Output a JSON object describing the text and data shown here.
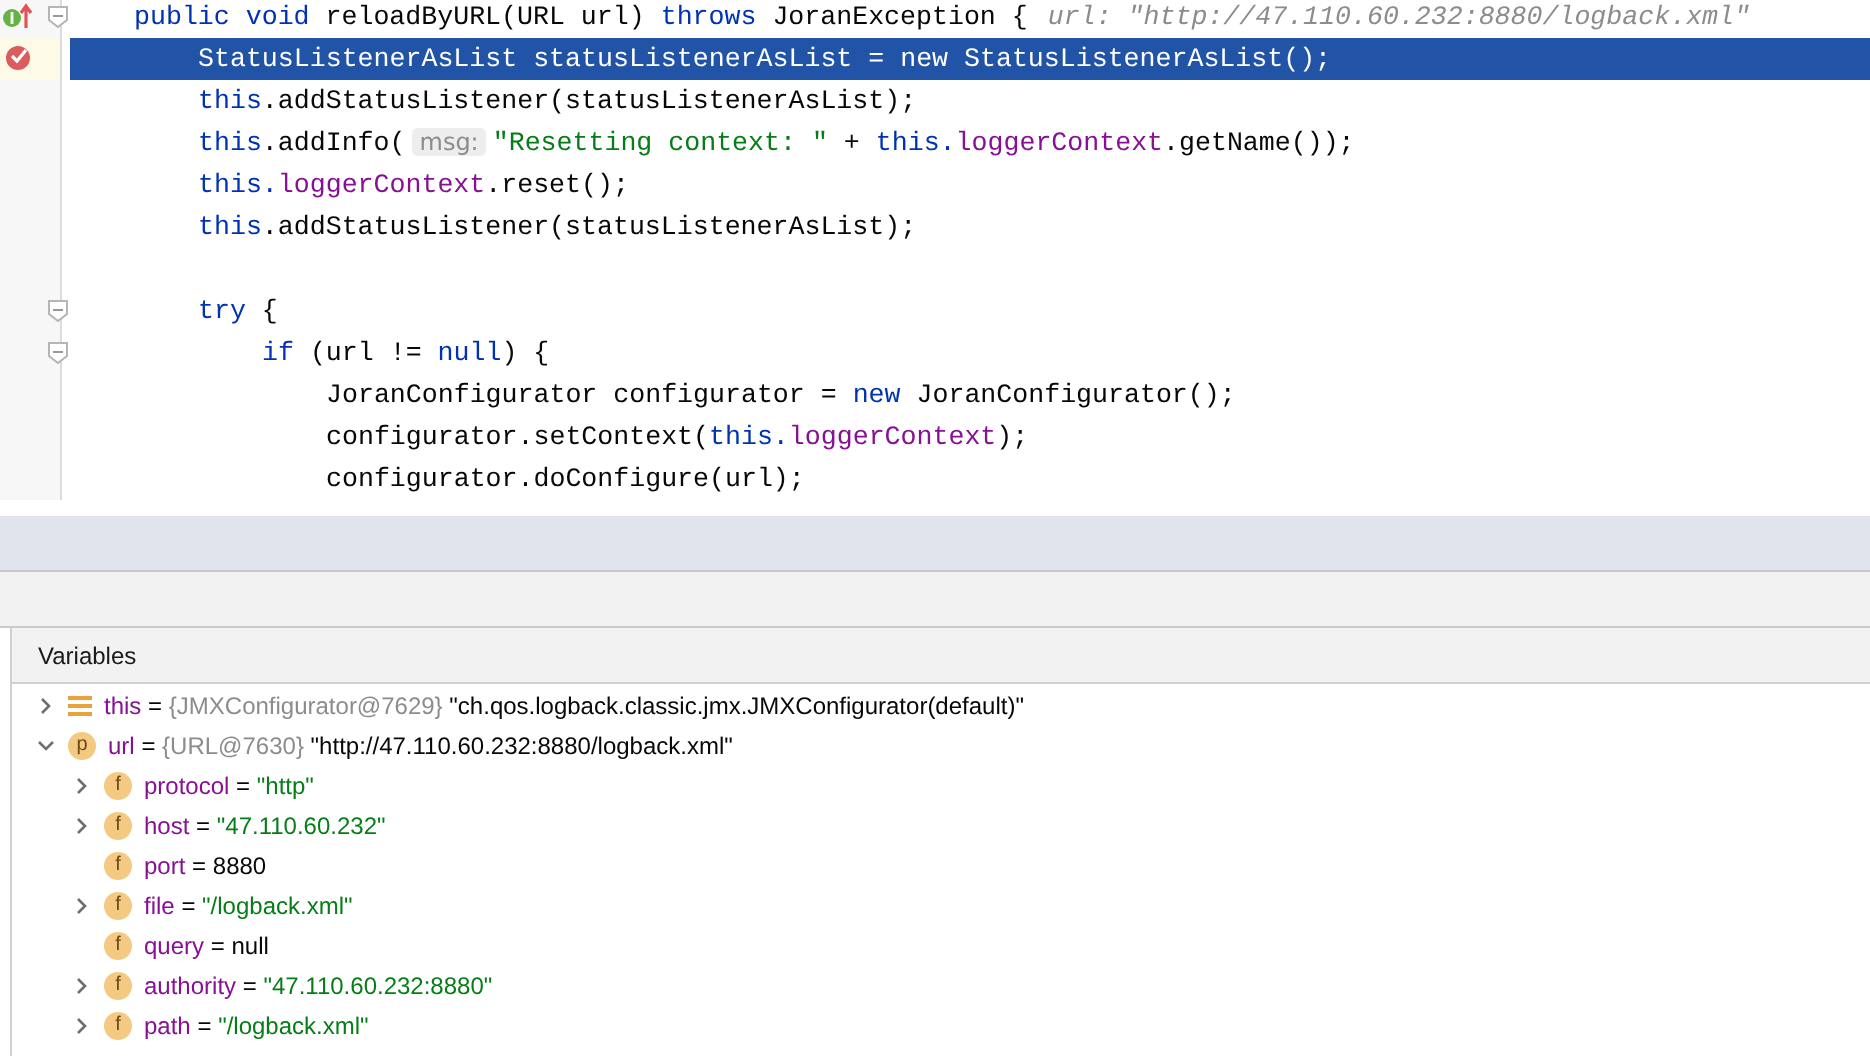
{
  "editor": {
    "lines": [
      {
        "kind": "implements",
        "fold": true,
        "selected": false,
        "segments": [
          {
            "kind": "kw",
            "text": "public void "
          },
          {
            "kind": "plain",
            "text": "reloadByURL(URL url) "
          },
          {
            "kind": "kw",
            "text": "throws "
          },
          {
            "kind": "plain",
            "text": "JoranException {"
          },
          {
            "kind": "inline-hint",
            "text": "url: \"http://47.110.60.232:8880/logback.xml\""
          }
        ],
        "children": [
          {
            "kind": "breakpoint",
            "fold": false,
            "selected": true,
            "segments": [
              {
                "kind": "plain",
                "text": "StatusListenerAsList statusListenerAsList = new StatusListenerAsList();"
              }
            ]
          },
          {
            "fold": false,
            "selected": false,
            "segments": [
              {
                "kind": "kw",
                "text": "this"
              },
              {
                "kind": "plain",
                "text": ".addStatusListener(statusListenerAsList);"
              }
            ]
          },
          {
            "fold": false,
            "selected": false,
            "segments": [
              {
                "kind": "kw",
                "text": "this"
              },
              {
                "kind": "plain",
                "text": ".addInfo("
              },
              {
                "kind": "param-hint",
                "text": "msg:"
              },
              {
                "kind": "str",
                "text": "\"Resetting context: \""
              },
              {
                "kind": "plain",
                "text": " + "
              },
              {
                "kind": "kw",
                "text": "this."
              },
              {
                "kind": "field",
                "text": "loggerContext"
              },
              {
                "kind": "plain",
                "text": ".getName());"
              }
            ]
          },
          {
            "fold": false,
            "selected": false,
            "segments": [
              {
                "kind": "kw",
                "text": "this."
              },
              {
                "kind": "field",
                "text": "loggerContext"
              },
              {
                "kind": "plain",
                "text": ".reset();"
              }
            ]
          },
          {
            "fold": false,
            "selected": false,
            "segments": [
              {
                "kind": "kw",
                "text": "this"
              },
              {
                "kind": "plain",
                "text": ".addStatusListener(statusListenerAsList);"
              }
            ]
          },
          {
            "fold": false,
            "selected": false
          },
          {
            "fold": true,
            "selected": false,
            "segments": [
              {
                "kind": "kw",
                "text": "try "
              },
              {
                "kind": "plain",
                "text": "{"
              }
            ],
            "children": [
              {
                "fold": true,
                "selected": false,
                "segments": [
                  {
                    "kind": "kw",
                    "text": "if "
                  },
                  {
                    "kind": "plain",
                    "text": "(url != "
                  },
                  {
                    "kind": "kw",
                    "text": "null"
                  },
                  {
                    "kind": "plain",
                    "text": ") {"
                  }
                ],
                "children": [
                  {
                    "fold": false,
                    "selected": false,
                    "segments": [
                      {
                        "kind": "plain",
                        "text": "JoranConfigurator configurator = "
                      },
                      {
                        "kind": "kw",
                        "text": "new "
                      },
                      {
                        "kind": "plain",
                        "text": "JoranConfigurator();"
                      }
                    ]
                  },
                  {
                    "fold": false,
                    "selected": false,
                    "segments": [
                      {
                        "kind": "plain",
                        "text": "configurator.setContext("
                      },
                      {
                        "kind": "kw",
                        "text": "this."
                      },
                      {
                        "kind": "field",
                        "text": "loggerContext"
                      },
                      {
                        "kind": "plain",
                        "text": ");"
                      }
                    ]
                  },
                  {
                    "fold": false,
                    "selected": false,
                    "segments": [
                      {
                        "kind": "plain",
                        "text": "configurator.doConfigure(url);"
                      }
                    ]
                  }
                ]
              }
            ]
          }
        ]
      }
    ]
  },
  "variables_panel": {
    "title": "Variables",
    "tree": [
      {
        "kind": "local",
        "expandable": true,
        "expanded": false,
        "name": "this",
        "sep": "=",
        "ref": "{JMXConfigurator@7629}",
        "value": {
          "text": "\"ch.qos.logback.classic.jmx.JMXConfigurator(default)\""
        }
      },
      {
        "kind": "param",
        "badge": "p",
        "expandable": true,
        "expanded": true,
        "name": "url",
        "sep": "=",
        "ref": "{URL@7630}",
        "value": {
          "text": "\"http://47.110.60.232:8880/logback.xml\""
        },
        "children": [
          {
            "kind": "field",
            "badge": "f",
            "expandable": true,
            "expanded": false,
            "name": "protocol",
            "sep": "=",
            "value": {
              "kind": "string",
              "text": "\"http\""
            }
          },
          {
            "kind": "field",
            "badge": "f",
            "expandable": true,
            "expanded": false,
            "name": "host",
            "sep": "=",
            "value": {
              "kind": "string",
              "text": "\"47.110.60.232\""
            }
          },
          {
            "kind": "field",
            "badge": "f",
            "expandable": false,
            "expanded": false,
            "name": "port",
            "sep": "=",
            "value": {
              "text": "8880"
            }
          },
          {
            "kind": "field",
            "badge": "f",
            "expandable": true,
            "expanded": false,
            "name": "file",
            "sep": "=",
            "value": {
              "kind": "string",
              "text": "\"/logback.xml\""
            }
          },
          {
            "kind": "field",
            "badge": "f",
            "expandable": false,
            "expanded": false,
            "name": "query",
            "sep": "=",
            "value": {
              "text": "null"
            }
          },
          {
            "kind": "field",
            "badge": "f",
            "expandable": true,
            "expanded": false,
            "name": "authority",
            "sep": "=",
            "value": {
              "kind": "string",
              "text": "\"47.110.60.232:8880\""
            }
          },
          {
            "kind": "field",
            "badge": "f",
            "expandable": true,
            "expanded": false,
            "name": "path",
            "sep": "=",
            "value": {
              "kind": "string",
              "text": "\"/logback.xml\""
            }
          }
        ]
      }
    ]
  }
}
